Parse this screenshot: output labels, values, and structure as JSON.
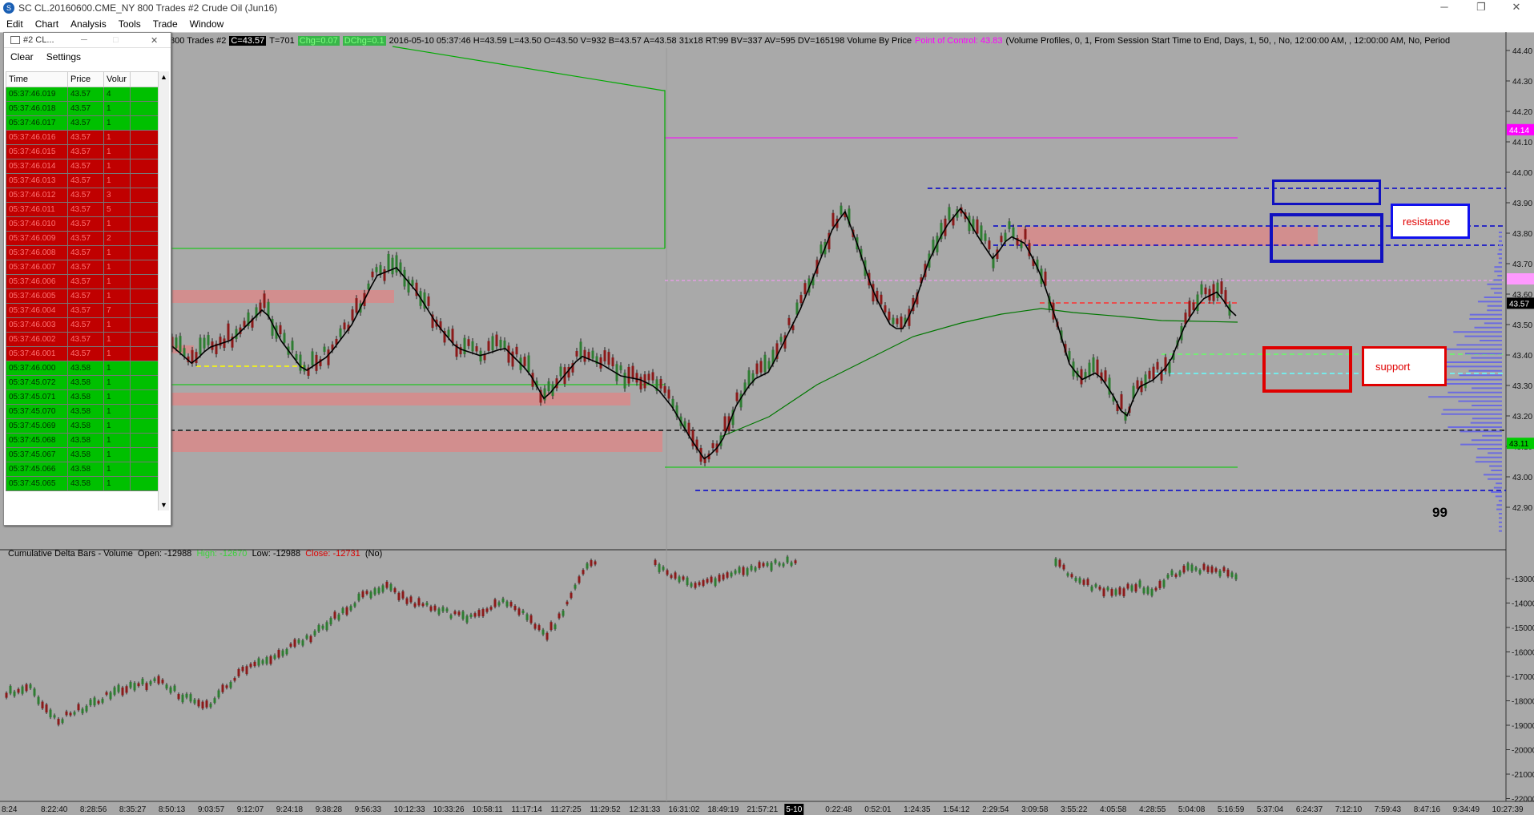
{
  "window": {
    "title": "SC CL.20160600.CME_NY  800 Trades  #2  Crude Oil (Jun16)",
    "min": "─",
    "restore": "❐",
    "close": "✕"
  },
  "menu": [
    "Edit",
    "Chart",
    "Analysis",
    "Tools",
    "Trade",
    "Window"
  ],
  "infobar": {
    "prefix": "800 Trades  #2",
    "close_box": "C=43.57",
    "ticks": "T=701",
    "chg": "Chg=0.07",
    "dchg": "DChg=0.1",
    "main": "2016-05-10  05:37:46  H=43.59  L=43.50  O=43.50  V=932  B=43.57  A=43.58  31x18  RT:99  BV=337  AV=595  DV=165198  Volume By Price",
    "poc": "Point of Control: 43.83",
    "profile": "(Volume Profiles, 0, 1, From Session Start Time to End, Days, 1, 50, , No, 12:00:00 AM, , 12:00:00 AM, No, Period"
  },
  "delta_label": {
    "name": "Cumulative Delta Bars - Volume",
    "open": "Open: -12988",
    "high": "High: -12670",
    "low": "Low: -12988",
    "close": "Close: -12731",
    "tail": "(No)"
  },
  "price_axis": {
    "ticks": [
      "44.40",
      "44.30",
      "44.20",
      "44.10",
      "44.00",
      "43.90",
      "43.80",
      "43.70",
      "43.60",
      "43.50",
      "43.40",
      "43.30",
      "43.20",
      "43.10",
      "43.00",
      "42.90"
    ],
    "markers": {
      "high": "44.14",
      "pink": "43.65",
      "last": "43.57",
      "low": "43.11"
    }
  },
  "delta_axis": {
    "ticks": [
      "-13000",
      "-14000",
      "-15000",
      "-16000",
      "-17000",
      "-18000",
      "-19000",
      "-20000",
      "-21000",
      "-22000"
    ]
  },
  "time_axis": [
    "8:24",
    "8:22:40",
    "8:28:56",
    "8:35:27",
    "8:50:13",
    "9:03:57",
    "9:12:07",
    "9:24:18",
    "9:38:28",
    "9:56:33",
    "10:12:33",
    "10:33:26",
    "10:58:11",
    "11:17:14",
    "11:27:25",
    "11:29:52",
    "12:31:33",
    "16:31:02",
    "18:49:19",
    "21:57:21",
    "5-10",
    "0:22:48",
    "0:52:01",
    "1:24:35",
    "1:54:12",
    "2:29:54",
    "3:09:58",
    "3:55:22",
    "4:05:58",
    "4:28:55",
    "5:04:08",
    "5:16:59",
    "5:37:04",
    "6:24:37",
    "7:12:10",
    "7:59:43",
    "8:47:16",
    "9:34:49",
    "10:27:39"
  ],
  "annotations": {
    "resistance": "resistance",
    "support": "support",
    "count": "99"
  },
  "time_and_sales": {
    "title": "#2  CL...",
    "clear": "Clear",
    "settings": "Settings",
    "headers": [
      "Time",
      "Price",
      "Volur"
    ],
    "rows": [
      {
        "time": "05:37:46.019",
        "price": "43.57",
        "vol": "4",
        "side": "up"
      },
      {
        "time": "05:37:46.018",
        "price": "43.57",
        "vol": "1",
        "side": "up"
      },
      {
        "time": "05:37:46.017",
        "price": "43.57",
        "vol": "1",
        "side": "up"
      },
      {
        "time": "05:37:46.016",
        "price": "43.57",
        "vol": "1",
        "side": "dn"
      },
      {
        "time": "05:37:46.015",
        "price": "43.57",
        "vol": "1",
        "side": "dn"
      },
      {
        "time": "05:37:46.014",
        "price": "43.57",
        "vol": "1",
        "side": "dn"
      },
      {
        "time": "05:37:46.013",
        "price": "43.57",
        "vol": "1",
        "side": "dn"
      },
      {
        "time": "05:37:46.012",
        "price": "43.57",
        "vol": "3",
        "side": "dn"
      },
      {
        "time": "05:37:46.011",
        "price": "43.57",
        "vol": "5",
        "side": "dn"
      },
      {
        "time": "05:37:46.010",
        "price": "43.57",
        "vol": "1",
        "side": "dn"
      },
      {
        "time": "05:37:46.009",
        "price": "43.57",
        "vol": "2",
        "side": "dn"
      },
      {
        "time": "05:37:46.008",
        "price": "43.57",
        "vol": "1",
        "side": "dn"
      },
      {
        "time": "05:37:46.007",
        "price": "43.57",
        "vol": "1",
        "side": "dn"
      },
      {
        "time": "05:37:46.006",
        "price": "43.57",
        "vol": "1",
        "side": "dn"
      },
      {
        "time": "05:37:46.005",
        "price": "43.57",
        "vol": "1",
        "side": "dn"
      },
      {
        "time": "05:37:46.004",
        "price": "43.57",
        "vol": "7",
        "side": "dn"
      },
      {
        "time": "05:37:46.003",
        "price": "43.57",
        "vol": "1",
        "side": "dn"
      },
      {
        "time": "05:37:46.002",
        "price": "43.57",
        "vol": "1",
        "side": "dn"
      },
      {
        "time": "05:37:46.001",
        "price": "43.57",
        "vol": "1",
        "side": "dn"
      },
      {
        "time": "05:37:46.000",
        "price": "43.58",
        "vol": "1",
        "side": "up"
      },
      {
        "time": "05:37:45.072",
        "price": "43.58",
        "vol": "1",
        "side": "up"
      },
      {
        "time": "05:37:45.071",
        "price": "43.58",
        "vol": "1",
        "side": "up"
      },
      {
        "time": "05:37:45.070",
        "price": "43.58",
        "vol": "1",
        "side": "up"
      },
      {
        "time": "05:37:45.069",
        "price": "43.58",
        "vol": "1",
        "side": "up"
      },
      {
        "time": "05:37:45.068",
        "price": "43.58",
        "vol": "1",
        "side": "up"
      },
      {
        "time": "05:37:45.067",
        "price": "43.58",
        "vol": "1",
        "side": "up"
      },
      {
        "time": "05:37:45.066",
        "price": "43.58",
        "vol": "1",
        "side": "up"
      },
      {
        "time": "05:37:45.065",
        "price": "43.58",
        "vol": "1",
        "side": "up"
      }
    ]
  },
  "colors": {
    "up": "#2e7d32",
    "down": "#8b1a1a",
    "zone": "#d98a8a",
    "accent_blue": "#0000cc",
    "accent_red": "#e00000"
  }
}
